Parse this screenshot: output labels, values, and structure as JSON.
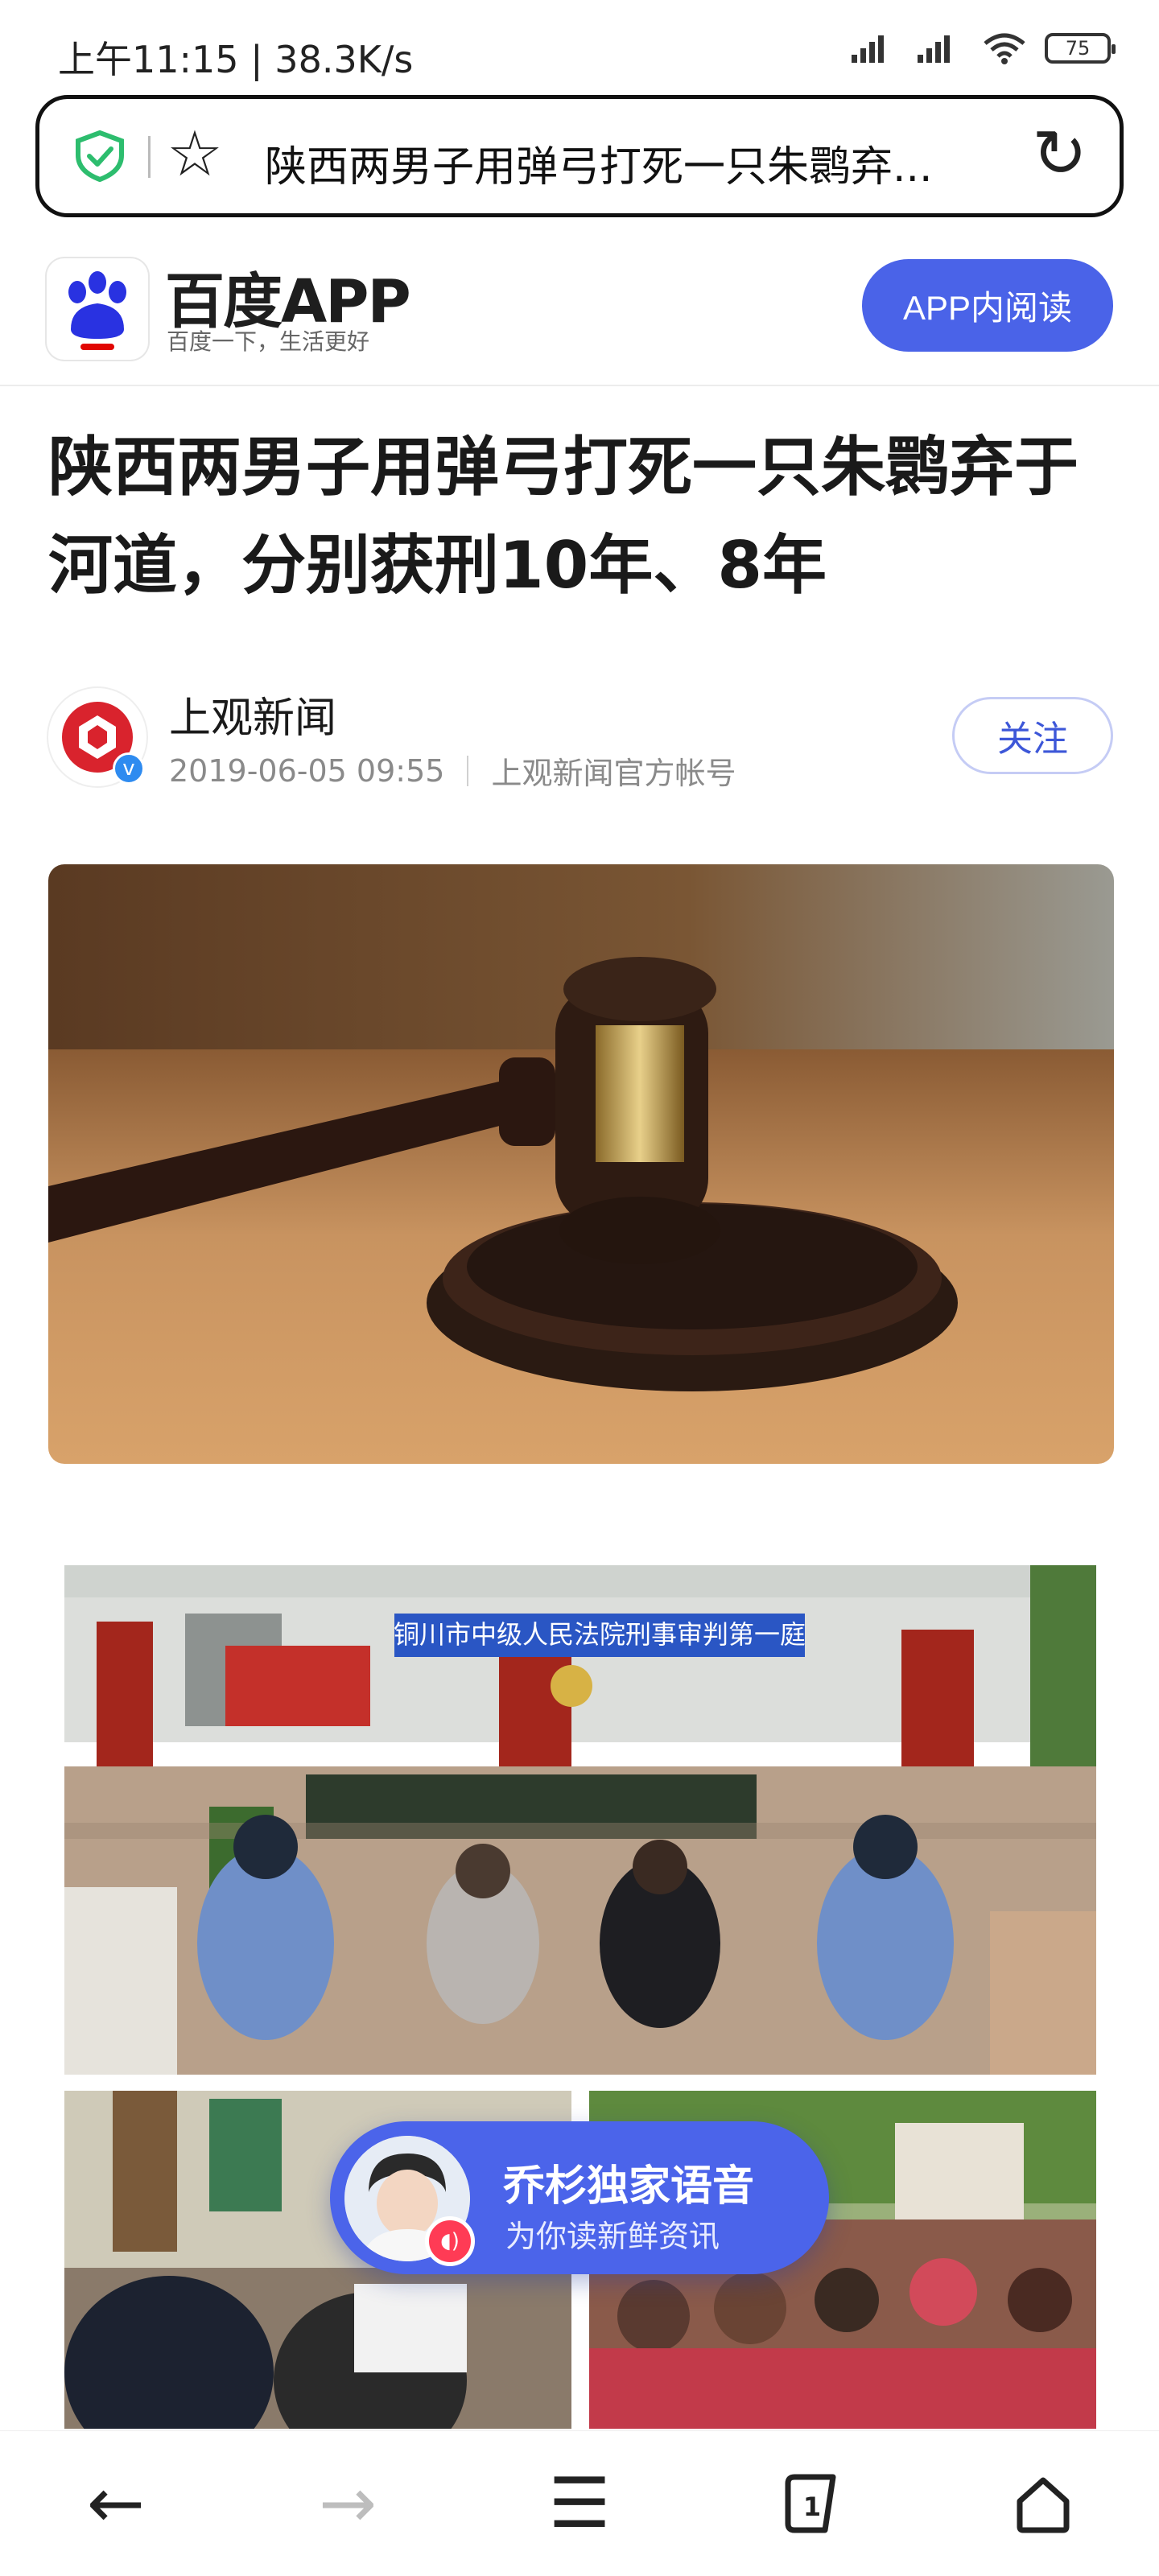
{
  "status_bar": {
    "time": "上午11:15 | 38.3K/s",
    "battery": "75"
  },
  "url_bar": {
    "text": "陕西两男子用弹弓打死一只朱鹮弃..."
  },
  "baidu_header": {
    "brand": "百度APP",
    "logo_text": "du",
    "slogan": "百度一下，生活更好",
    "app_read_button": "APP内阅读"
  },
  "article": {
    "title": "陕西两男子用弹弓打死一只朱鹮弃于河道，分别获刑10年、8年",
    "author": {
      "name": "上观新闻",
      "date": "2019-06-05 09:55",
      "account": "上观新闻官方帐号",
      "verified_mark": "v"
    },
    "follow_button": "关注",
    "court_banner": "铜川市中级人民法院刑事审判第一庭"
  },
  "voice_card": {
    "title": "乔杉独家语音",
    "subtitle": "为你读新鲜资讯"
  },
  "bottom_nav": {
    "back": "←",
    "forward": "→",
    "menu": "☰",
    "tabs": "1",
    "home": "⌂"
  },
  "colors": {
    "accent": "#4a63e8",
    "baidu_blue": "#2932e1",
    "baidu_red": "#e10602",
    "shield_green": "#2dbd6e"
  }
}
